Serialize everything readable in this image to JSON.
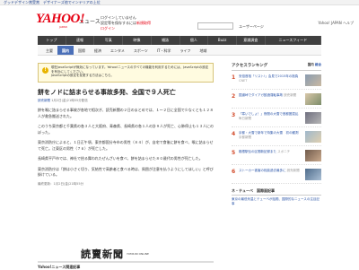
{
  "topbar": {
    "items": [
      "グッドデザイン賞受賞",
      "デザイナーズ他でインテリアの上位"
    ]
  },
  "header": {
    "logo_text": "YAHOO!",
    "logo_sub": "JAPAN",
    "brand": "ニュース",
    "msg_line1": "ログインしていません",
    "msg_line2_prefix": "設定等を保存するには",
    "msg_line2_link": "新規取得",
    "msg_line3": "ログイン",
    "right_links": "Yahoo! JAPAN ヘルプ",
    "search_placeholder": "ユーザーページ",
    "user_label": "ユーザーページ"
  },
  "nav_primary": [
    {
      "label": "トップ",
      "active": false
    },
    {
      "label": "速報",
      "active": false
    },
    {
      "label": "写真",
      "active": false
    },
    {
      "label": "映像",
      "active": false
    },
    {
      "label": "雑誌",
      "active": false
    },
    {
      "label": "個人",
      "active": false
    },
    {
      "label": "Buzz",
      "active": false
    },
    {
      "label": "意識調査",
      "active": false
    },
    {
      "label": "ニュースフィード",
      "active": false
    }
  ],
  "nav_secondary": [
    {
      "label": "主要",
      "active": false
    },
    {
      "label": "国内",
      "active": true
    },
    {
      "label": "国際",
      "active": false
    },
    {
      "label": "経済",
      "active": false
    },
    {
      "label": "エンタメ",
      "active": false
    },
    {
      "label": "スポーツ",
      "active": false
    },
    {
      "label": "IT・科学",
      "active": false
    },
    {
      "label": "ライフ",
      "active": false
    },
    {
      "label": "地域",
      "active": false
    }
  ],
  "notice": {
    "line1": "現在JavaScriptが無効になっています。Yahoo!ニュースのすべての機能を利用するためには、JavaScriptの設定を有効にしてください。",
    "line2": "JavaScriptの設定を変更する方法はこちら。"
  },
  "article": {
    "title": "餅をノドに詰まらせる事故多発、全国で９人死亡",
    "source": "読売新聞",
    "meta_time": "1月2日(金)21時55分配信",
    "paragraphs": [
      "餅を喉に詰まらせる事故が各地で相次ぎ、読売新聞の２日のまとめでは、１～２日に全国で少なくとも１２８人が救急搬送された。",
      "このうち東京都と千葉県の各３人と大阪府、青森県、長崎県の各１人の計９人が死亡、心肺停止も１３人にのぼった。",
      "東京消防庁によると、１日正午頃、東京都国分寺市の男性（８４）が、自宅で食後に餅を食べ、喉に詰まらせて死亡。江東区の男性（７６）が死亡した。",
      "長崎県平戸市では、神社で拾る舞われたぜんざいを食べ、餅を詰まらせた８０歳代の男性が死亡した。",
      "東京消防庁は「餅は小さく切り、気結性で高齢者と食べる時は、周囲が注意を払うようにしてほしい」と呼び掛けている。"
    ],
    "dateline": "最終更新：1月2日(金)21時55分",
    "paper_logo": "読賣新聞",
    "paper_small": "YOMIURI ONLINE",
    "related_heading": "Yahoo!ニュース関連記事"
  },
  "sidebar": {
    "heading": "アクセスランキング",
    "tabs": [
      "国内",
      "総合"
    ],
    "items": [
      {
        "num": "1",
        "text": "安倍首相「リスト!」会見で2015年の抱負",
        "source": "CNET",
        "thumb": "t1"
      },
      {
        "num": "2",
        "text": "国道峠でダイアガ飲酒運転事故",
        "source": "読売新聞",
        "thumb": "t2"
      },
      {
        "num": "3",
        "text": "「寒いでしょ！」夜間の大雪で首都圏混乱",
        "source": "毎日新聞",
        "thumb": "t3"
      },
      {
        "num": "4",
        "text": "京都・大雪で新年で特集の大雪　初の観測",
        "source": "京都新聞",
        "thumb": "t4"
      },
      {
        "num": "5",
        "text": "箱根駅伝の区間新記録また",
        "source": "スポニチ",
        "thumb": "t5"
      },
      {
        "num": "6",
        "text": "ストーカー被害の相談過去最多に",
        "source": "読売新聞",
        "thumb": "t6"
      }
    ],
    "sub_heading": "ネ・テューベ　国際面記事",
    "sub_text": "東京の最低気温とテューベが話題、国際的なニュースの注目記事"
  }
}
